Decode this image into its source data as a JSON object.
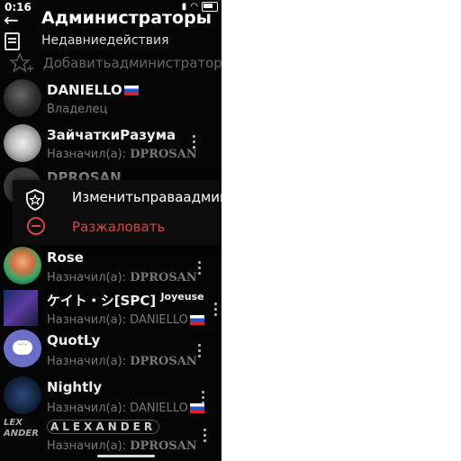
{
  "status": {
    "time": "0:16",
    "battery": ""
  },
  "header": {
    "title": "Администраторы"
  },
  "recent_actions": "Недавниедействия",
  "add_admin": "Добавитьадминистратора",
  "admins": [
    {
      "name": "DANIELLO",
      "flag": true,
      "role_prefix": "Владелец",
      "role_by": ""
    },
    {
      "name": "ЗайчаткиРазума",
      "flag": false,
      "role_prefix": "Назначил(а): ",
      "role_by": "DPROSAN"
    },
    {
      "name": "DPROSAN",
      "flag": false,
      "role_prefix": "",
      "role_by": ""
    },
    {
      "name": "Rose",
      "flag": false,
      "role_prefix": "Назначил(а): ",
      "role_by": "DPROSAN"
    },
    {
      "name": "ケイト・シ[SPC]",
      "suffix": "Joyeuse",
      "flag": false,
      "role_prefix": "Назначил(а): DANIELLO",
      "role_by": "",
      "role_flag": true
    },
    {
      "name": "QuotLy",
      "flag": false,
      "role_prefix": "Назначил(а): ",
      "role_by": "DPROSAN"
    },
    {
      "name": "Nightly",
      "flag": false,
      "role_prefix": "Назначил(а): DANIELLO",
      "role_by": "",
      "role_flag": true
    },
    {
      "name": "ALEXANDER",
      "flag": false,
      "role_prefix": "Назначил(а): ",
      "role_by": "DPROSAN"
    }
  ],
  "menu": {
    "edit_rights": "Изменитьправаадмина",
    "demote": "Разжаловать"
  },
  "colors": {
    "background": "#050505",
    "danger": "#d24646",
    "muted": "#777777"
  }
}
